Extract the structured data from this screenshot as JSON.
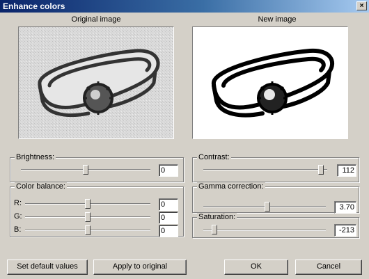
{
  "window": {
    "title": "Enhance colors",
    "close_label": "×"
  },
  "previews": {
    "original_label": "Original image",
    "new_label": "New image"
  },
  "brightness": {
    "label": "Brightness:",
    "value": "0",
    "level": 0.5
  },
  "contrast": {
    "label": "Contrast:",
    "value": "112",
    "level": 0.95
  },
  "color_balance": {
    "label": "Color balance:",
    "channels": [
      {
        "label": "R:",
        "value": "0",
        "level": 0.5
      },
      {
        "label": "G:",
        "value": "0",
        "level": 0.5
      },
      {
        "label": "B:",
        "value": "0",
        "level": 0.5
      }
    ]
  },
  "gamma": {
    "label": "Gamma correction:",
    "value": "3.70",
    "level": 0.54
  },
  "saturation": {
    "label": "Saturation:",
    "value": "-213",
    "level": 0.08
  },
  "buttons": {
    "set_default": "Set default values",
    "apply": "Apply to original",
    "ok": "OK",
    "cancel": "Cancel"
  },
  "colors": {
    "title_start": "#0a246a",
    "title_end": "#a6caf0",
    "face": "#d4d0c8"
  },
  "icons": {
    "close": "close-icon"
  }
}
